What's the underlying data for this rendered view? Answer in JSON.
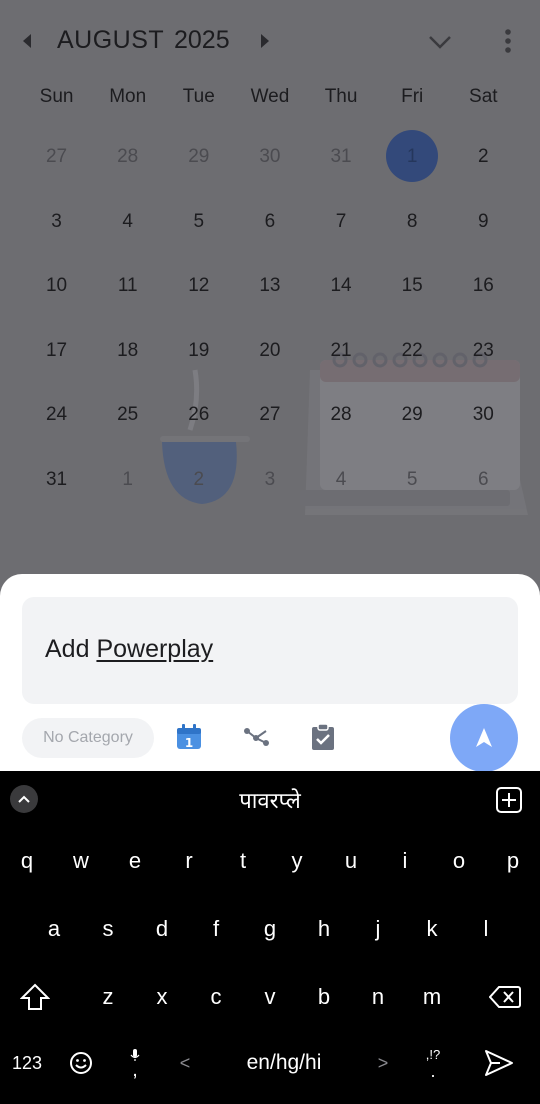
{
  "calendar": {
    "month": "AUGUST",
    "year": "2025",
    "weekdays": [
      "Sun",
      "Mon",
      "Tue",
      "Wed",
      "Thu",
      "Fri",
      "Sat"
    ],
    "weeks": [
      [
        {
          "d": "27",
          "o": true
        },
        {
          "d": "28",
          "o": true
        },
        {
          "d": "29",
          "o": true
        },
        {
          "d": "30",
          "o": true
        },
        {
          "d": "31",
          "o": true
        },
        {
          "d": "1",
          "t": true
        },
        {
          "d": "2"
        }
      ],
      [
        {
          "d": "3"
        },
        {
          "d": "4"
        },
        {
          "d": "5"
        },
        {
          "d": "6"
        },
        {
          "d": "7"
        },
        {
          "d": "8"
        },
        {
          "d": "9"
        }
      ],
      [
        {
          "d": "10"
        },
        {
          "d": "11"
        },
        {
          "d": "12"
        },
        {
          "d": "13"
        },
        {
          "d": "14"
        },
        {
          "d": "15"
        },
        {
          "d": "16"
        }
      ],
      [
        {
          "d": "17"
        },
        {
          "d": "18"
        },
        {
          "d": "19"
        },
        {
          "d": "20"
        },
        {
          "d": "21"
        },
        {
          "d": "22"
        },
        {
          "d": "23"
        }
      ],
      [
        {
          "d": "24"
        },
        {
          "d": "25"
        },
        {
          "d": "26"
        },
        {
          "d": "27"
        },
        {
          "d": "28"
        },
        {
          "d": "29"
        },
        {
          "d": "30"
        }
      ],
      [
        {
          "d": "31"
        },
        {
          "d": "1",
          "o": true
        },
        {
          "d": "2",
          "o": true
        },
        {
          "d": "3",
          "o": true
        },
        {
          "d": "4",
          "o": true
        },
        {
          "d": "5",
          "o": true
        },
        {
          "d": "6",
          "o": true
        }
      ]
    ],
    "icons": {
      "prev": "chevron-left-icon",
      "next": "chevron-right-icon",
      "toggle": "chevron-down-icon",
      "more": "more-vertical-icon"
    }
  },
  "sheet": {
    "input_prefix": "Add ",
    "input_underlined": "Powerplay",
    "category_chip": "No Category",
    "tools": [
      "calendar-icon",
      "share-icon",
      "clipboard-check-icon"
    ],
    "send_icon": "send-arrow-icon",
    "accent": "#7ea8f7"
  },
  "keyboard": {
    "suggestion": "पावरप्ले",
    "row1": [
      "q",
      "w",
      "e",
      "r",
      "t",
      "y",
      "u",
      "i",
      "o",
      "p"
    ],
    "row2": [
      "a",
      "s",
      "d",
      "f",
      "g",
      "h",
      "j",
      "k",
      "l"
    ],
    "row3": [
      "z",
      "x",
      "c",
      "v",
      "b",
      "n",
      "m"
    ],
    "numbers_key": "123",
    "comma_key": ",",
    "space_label": "en/hg/hi",
    "punct_key_top": ",!?",
    "punct_key_bottom": ".",
    "left_arrow": "<",
    "right_arrow": ">"
  }
}
